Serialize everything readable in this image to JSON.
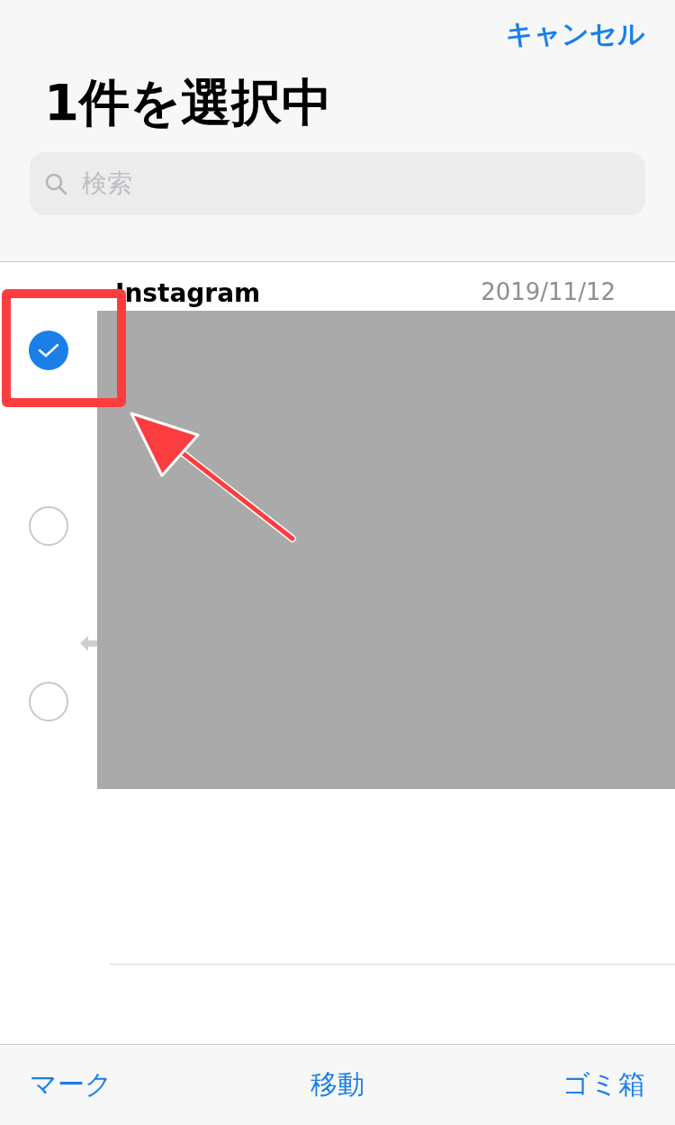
{
  "nav": {
    "cancel": "キャンセル"
  },
  "title": "1件を選択中",
  "search": {
    "placeholder": "検索"
  },
  "messages": [
    {
      "sender": "Instagram",
      "date": "2019/11/12",
      "selected": true,
      "replied": false
    },
    {
      "selected": false,
      "replied": false
    },
    {
      "selected": false,
      "replied": true
    }
  ],
  "toolbar": [
    "マーク",
    "移動",
    "ゴミ箱"
  ]
}
